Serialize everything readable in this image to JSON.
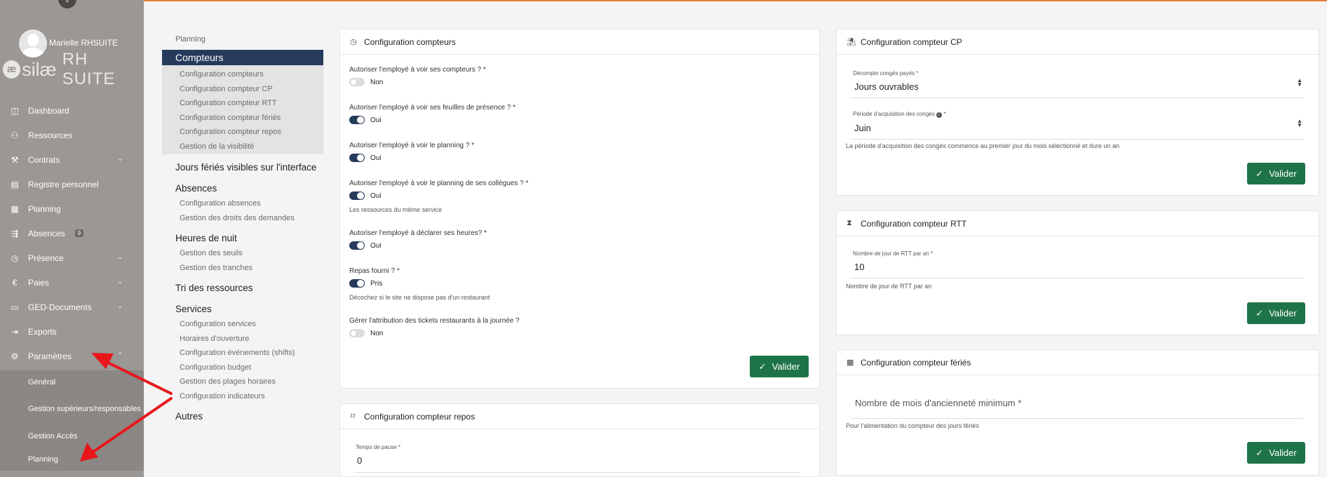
{
  "sidebar": {
    "username": "Marielle RHSUITE",
    "brand_name": "silæ",
    "brand_suite": "RH SUITE",
    "brand_mark": "æ",
    "items": [
      {
        "label": "Dashboard",
        "icon": "dashboard-icon",
        "glyph": "◫"
      },
      {
        "label": "Ressources",
        "icon": "users-icon",
        "glyph": "⚇"
      },
      {
        "label": "Contrats",
        "icon": "hammer-icon",
        "glyph": "⚒"
      },
      {
        "label": "Registre personnel",
        "icon": "register-icon",
        "glyph": "▤"
      },
      {
        "label": "Planning",
        "icon": "calendar-icon",
        "glyph": "▦"
      },
      {
        "label": "Absences",
        "icon": "absences-icon",
        "glyph": "⇶",
        "badge": "9"
      },
      {
        "label": "Présence",
        "icon": "clock-icon",
        "glyph": "◷"
      },
      {
        "label": "Paies",
        "icon": "euro-icon",
        "glyph": "€"
      },
      {
        "label": "GED-Documents",
        "icon": "folder-icon",
        "glyph": "▭"
      },
      {
        "label": "Exports",
        "icon": "export-icon",
        "glyph": "⇥"
      },
      {
        "label": "Paramètres",
        "icon": "gear-icon",
        "glyph": "⚙"
      }
    ],
    "subitems": [
      "Général",
      "Gestion supérieurs/responsables",
      "Gestion Accès",
      "Planning"
    ]
  },
  "menu": {
    "caption": "Planning",
    "active": "Compteurs",
    "active_subs": [
      "Configuration compteurs",
      "Configuration compteur CP",
      "Configuration compteur RTT",
      "Configuration compteur fériés",
      "Configuration compteur repos",
      "Gestion de la visibilité"
    ],
    "jours_feries": "Jours fériés visibles sur l'interface",
    "absences": "Absences",
    "absences_subs": [
      "Configuration absences",
      "Gestion des droits des demandes"
    ],
    "heures_nuit": "Heures de nuit",
    "heures_subs": [
      "Gestion des seuils",
      "Gestion des tranches"
    ],
    "tri": "Tri des ressources",
    "services": "Services",
    "services_subs": [
      "Configuration services",
      "Horaires d'ouverture",
      "Configuration événements (shifts)",
      "Configuration budget",
      "Gestion des plages horaires",
      "Configuration indicateurs"
    ],
    "autres": "Autres"
  },
  "compteurs": {
    "title": "Configuration compteurs",
    "q1": "Autoriser l'employé à voir ses compteurs ? *",
    "q1_val": "Non",
    "q2": "Autoriser l'employé à voir ses feuilles de présence ? *",
    "q2_val": "Oui",
    "q3": "Autoriser l'employé à voir le planning ? *",
    "q3_val": "Oui",
    "q4": "Autoriser l'employé à voir le planning de ses collègues ? *",
    "q4_val": "Oui",
    "q4_hint": "Les ressources du même service",
    "q5": "Autoriser l'employé à déclarer ses heures? *",
    "q5_val": "Oui",
    "q6": "Repas fourni ? *",
    "q6_val": "Pris",
    "q6_hint": "Décochez si le site ne dispose pas d'un restaurant",
    "q7": "Gérer l'attribution des tickets restaurants à la journée ?",
    "q7_val": "Non",
    "valider": "Valider"
  },
  "repos": {
    "title": "Configuration compteur repos",
    "label": "Temps de pause *",
    "value": "0"
  },
  "cp": {
    "title": "Configuration compteur CP",
    "label1": "Décompte congés payés *",
    "value1": "Jours ouvrables",
    "label2": "Période d'acquisition des congés",
    "label2_star": "*",
    "value2": "Juin",
    "hint": "La période d'acquisition des congés commence au premier jour du mois sélectionné et dure un an",
    "valider": "Valider"
  },
  "rtt": {
    "title": "Configuration compteur RTT",
    "label": "Nombre de jour de RTT par an *",
    "value": "10",
    "hint": "Nombre de jour de RTT par an",
    "valider": "Valider"
  },
  "feries": {
    "title": "Configuration compteur fériés",
    "placeholder": "Nombre de mois d'ancienneté minimum *",
    "hint": "Pour l'alimentation du compteur des jours fériés",
    "valider": "Valider"
  },
  "colors": {
    "accent": "#263b5c",
    "button": "#1e7448",
    "sidebar": "#9a9794",
    "annotation_arrow": "#e8161b"
  }
}
